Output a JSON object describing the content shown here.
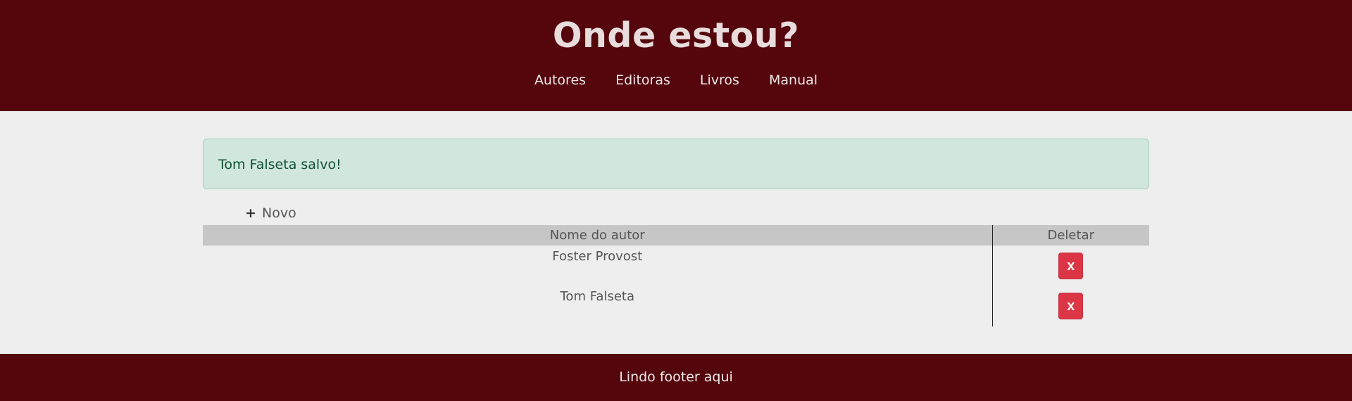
{
  "header": {
    "title": "Onde estou?",
    "nav": [
      {
        "label": "Autores"
      },
      {
        "label": "Editoras"
      },
      {
        "label": "Livros"
      },
      {
        "label": "Manual"
      }
    ]
  },
  "alert": {
    "message": "Tom Falseta salvo!"
  },
  "actions": {
    "new_plus": "+",
    "new_label": "Novo"
  },
  "table": {
    "columns": [
      "Nome do autor",
      "Deletar"
    ],
    "rows": [
      {
        "name": "Foster Provost",
        "delete_label": "x"
      },
      {
        "name": "Tom Falseta",
        "delete_label": "x"
      }
    ]
  },
  "footer": {
    "text": "Lindo footer aqui"
  },
  "colors": {
    "header_bg": "#54060c",
    "page_bg": "#eeeeee",
    "alert_bg": "#d1e7dd",
    "table_header_bg": "#c6c6c6",
    "delete_button": "#dc3545"
  }
}
